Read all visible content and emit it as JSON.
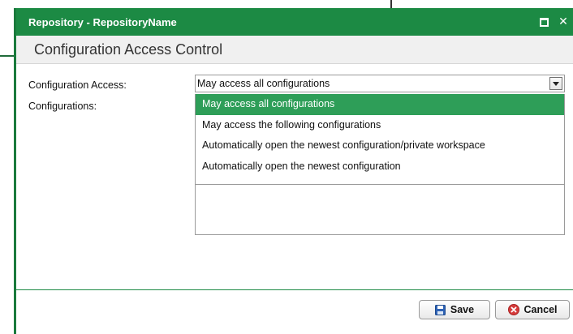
{
  "dialog": {
    "title": "Repository - RepositoryName",
    "maximize_icon": "maximize-icon",
    "close_glyph": "✕",
    "header": "Configuration Access Control",
    "accent_color": "#1c8a44",
    "selected_color": "#2e9e58"
  },
  "form": {
    "access_label": "Configuration Access:",
    "configs_label": "Configurations:",
    "access_value": "May access all configurations",
    "options": [
      "May access all configurations",
      "May access the following configurations",
      "Automatically open the newest configuration/private workspace",
      "Automatically open the newest configuration"
    ],
    "selected_index": 0
  },
  "footer": {
    "save_label": "Save",
    "cancel_label": "Cancel",
    "save_icon": "floppy-disk-icon",
    "cancel_icon": "cancel-circle-icon"
  }
}
